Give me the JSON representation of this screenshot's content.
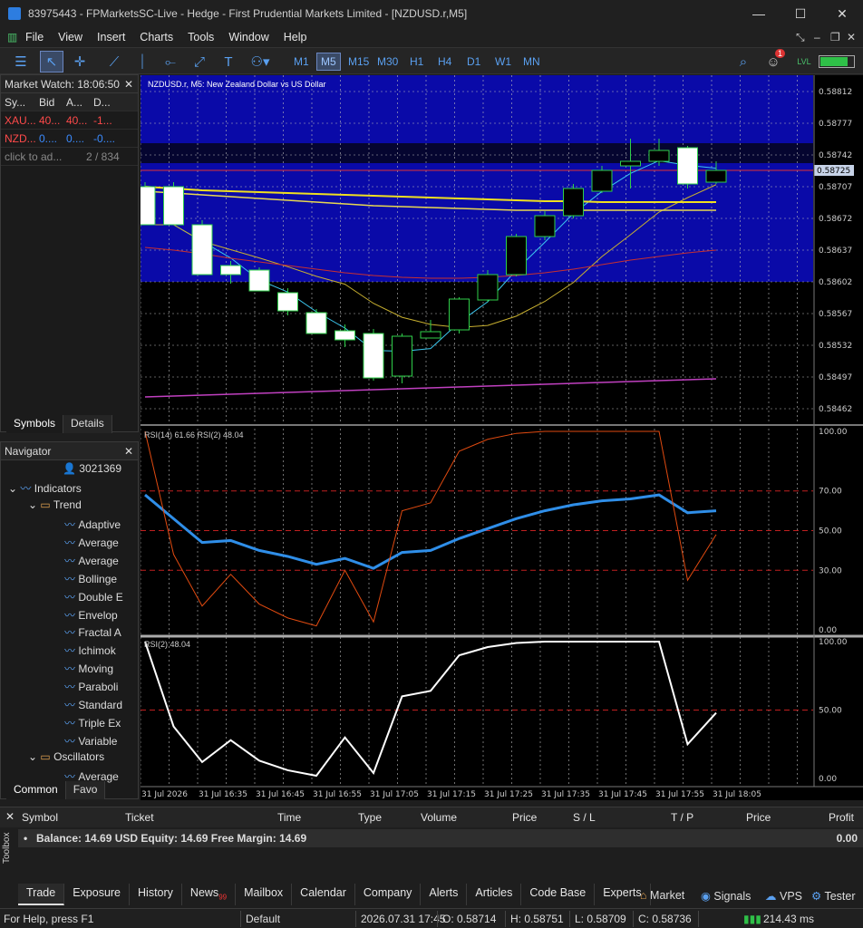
{
  "window": {
    "title": "83975443 - FPMarketsSC-Live - Hedge - First Prudential Markets Limited - [NZDUSD.r,M5]",
    "minimize": "—",
    "maximize": "☐",
    "close": "✕"
  },
  "menu": [
    "File",
    "View",
    "Insert",
    "Charts",
    "Tools",
    "Window",
    "Help"
  ],
  "timeframes": [
    "M1",
    "M5",
    "M15",
    "M30",
    "H1",
    "H4",
    "D1",
    "W1",
    "MN"
  ],
  "active_timeframe": "M5",
  "notification_count": "1",
  "market_watch": {
    "title": "Market Watch: 18:06:50",
    "headers": [
      "Sy...",
      "Bid",
      "A...",
      "D..."
    ],
    "rows": [
      {
        "symbol": "XAU...",
        "bid": "40...",
        "ask": "40...",
        "daily": "-1...",
        "color": "#ff4a4a"
      },
      {
        "symbol": "NZD...",
        "bid": "0....",
        "ask": "0....",
        "daily": "-0....",
        "color": "#3b8bff"
      }
    ],
    "add": "click to ad...",
    "count": "2 / 834",
    "tabs": [
      "Symbols",
      "Details"
    ]
  },
  "navigator": {
    "title": "Navigator",
    "account": "3021369",
    "indicators": "Indicators",
    "trend": "Trend",
    "trend_items": [
      "Adaptive",
      "Average",
      "Average",
      "Bollinge",
      "Double E",
      "Envelop",
      "Fractal A",
      "Ichimok",
      "Moving",
      "Paraboli",
      "Standard",
      "Triple Ex",
      "Variable"
    ],
    "oscillators": "Oscillators",
    "osc_items": [
      "Average"
    ],
    "tabs": [
      "Common",
      "Favo"
    ]
  },
  "chart": {
    "symbol_label": "NZDUSD.r, M5:  New Zealand Dollar vs US Dollar",
    "price_ticks": [
      "0.58812",
      "0.58777",
      "0.58742",
      "0.58707",
      "0.58672",
      "0.58637",
      "0.58602",
      "0.58567",
      "0.58532",
      "0.58497",
      "0.58462"
    ],
    "current_price": "0.58725",
    "rsi_label": "RSI(14) 61.66 RSI(2) 48.04",
    "rsi_ticks": [
      "100.00",
      "70.00",
      "50.00",
      "30.00",
      "0.00"
    ],
    "rsi2_label": "RSI(2) 48.04",
    "rsi2_ticks": [
      "100.00",
      "50.00",
      "0.00"
    ],
    "time_ticks": [
      "31 Jul 2026",
      "31 Jul 16:35",
      "31 Jul 16:45",
      "31 Jul 16:55",
      "31 Jul 17:05",
      "31 Jul 17:15",
      "31 Jul 17:25",
      "31 Jul 17:35",
      "31 Jul 17:45",
      "31 Jul 17:55",
      "31 Jul 18:05"
    ]
  },
  "chart_data": {
    "type": "candlestick",
    "candles": [
      {
        "o": 0.58707,
        "h": 0.58712,
        "l": 0.58665,
        "c": 0.58665
      },
      {
        "o": 0.58707,
        "h": 0.58712,
        "l": 0.58665,
        "c": 0.58665
      },
      {
        "o": 0.58665,
        "h": 0.5867,
        "l": 0.5861,
        "c": 0.5861
      },
      {
        "o": 0.5862,
        "h": 0.58625,
        "l": 0.586,
        "c": 0.5861
      },
      {
        "o": 0.58615,
        "h": 0.58618,
        "l": 0.58592,
        "c": 0.58592
      },
      {
        "o": 0.5859,
        "h": 0.58595,
        "l": 0.58565,
        "c": 0.5857
      },
      {
        "o": 0.58568,
        "h": 0.58572,
        "l": 0.58545,
        "c": 0.58545
      },
      {
        "o": 0.58548,
        "h": 0.58555,
        "l": 0.5853,
        "c": 0.58538
      },
      {
        "o": 0.58545,
        "h": 0.5855,
        "l": 0.58493,
        "c": 0.58496
      },
      {
        "o": 0.58498,
        "h": 0.58545,
        "l": 0.5849,
        "c": 0.58542
      },
      {
        "o": 0.5854,
        "h": 0.5856,
        "l": 0.5854,
        "c": 0.58547
      },
      {
        "o": 0.58549,
        "h": 0.58585,
        "l": 0.58545,
        "c": 0.58583
      },
      {
        "o": 0.58582,
        "h": 0.58615,
        "l": 0.5858,
        "c": 0.5861
      },
      {
        "o": 0.5861,
        "h": 0.58655,
        "l": 0.58608,
        "c": 0.58652
      },
      {
        "o": 0.58652,
        "h": 0.5868,
        "l": 0.58648,
        "c": 0.58675
      },
      {
        "o": 0.58675,
        "h": 0.5871,
        "l": 0.58672,
        "c": 0.58705
      },
      {
        "o": 0.58702,
        "h": 0.5873,
        "l": 0.587,
        "c": 0.58725
      },
      {
        "o": 0.5873,
        "h": 0.5876,
        "l": 0.58705,
        "c": 0.58735
      },
      {
        "o": 0.58735,
        "h": 0.5876,
        "l": 0.5873,
        "c": 0.58747
      },
      {
        "o": 0.5875,
        "h": 0.58752,
        "l": 0.58705,
        "c": 0.5871
      },
      {
        "o": 0.58712,
        "h": 0.58735,
        "l": 0.5871,
        "c": 0.58725
      }
    ],
    "rsi14": [
      68,
      56,
      44,
      45,
      40,
      37,
      33,
      36,
      31,
      39,
      40,
      46,
      51,
      56,
      60,
      63,
      65,
      66,
      68,
      59,
      60
    ],
    "rsi2": [
      100,
      38,
      12,
      28,
      13,
      6,
      2,
      30,
      4,
      60,
      64,
      90,
      96,
      99,
      100,
      100,
      100,
      100,
      100,
      25,
      48
    ],
    "yrange": [
      0.58445,
      0.5883
    ]
  },
  "toolbox": {
    "headers": [
      "Symbol",
      "Ticket",
      "Time",
      "Type",
      "Volume",
      "Price",
      "S / L",
      "T / P",
      "Price",
      "Profit"
    ],
    "balance": "Balance: 14.69 USD  Equity: 14.69  Free Margin: 14.69",
    "profit": "0.00",
    "label": "Toolbox",
    "tabs": [
      "Trade",
      "Exposure",
      "History",
      "News",
      "Mailbox",
      "Calendar",
      "Company",
      "Alerts",
      "Articles",
      "Code Base",
      "Experts"
    ],
    "news_count": "99",
    "right_tabs": [
      "Market",
      "Signals",
      "VPS",
      "Tester"
    ]
  },
  "status": {
    "help": "For Help, press F1",
    "profile": "Default",
    "datetime": "2026.07.31 17:45",
    "open": "O: 0.58714",
    "high": "H: 0.58751",
    "low": "L: 0.58709",
    "close": "C: 0.58736",
    "ping": "214.43 ms"
  }
}
